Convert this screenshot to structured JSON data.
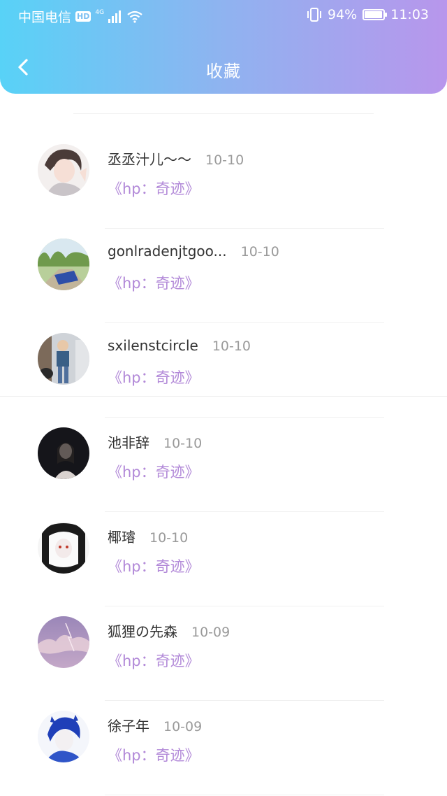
{
  "status_bar": {
    "carrier": "中国电信",
    "hd": "HD",
    "network": "4G",
    "battery": "94%",
    "time": "11:03"
  },
  "nav": {
    "title": "收藏"
  },
  "colors": {
    "accent": "#b289d8",
    "gradient_start": "#58d2f7",
    "gradient_end": "#b896ec"
  },
  "favorites": [
    {
      "name": "丞丞汁儿～～",
      "date": "10-10",
      "book": "《hp：奇迹》"
    },
    {
      "name": "gonlradenjtgoo...",
      "date": "10-10",
      "book": "《hp：奇迹》"
    },
    {
      "name": "sxilenstcircle",
      "date": "10-10",
      "book": "《hp：奇迹》"
    },
    {
      "name": "池非辞",
      "date": "10-10",
      "book": "《hp：奇迹》"
    },
    {
      "name": "椰璿",
      "date": "10-10",
      "book": "《hp：奇迹》"
    },
    {
      "name": "狐狸の先森",
      "date": "10-09",
      "book": "《hp：奇迹》"
    },
    {
      "name": "徐子年",
      "date": "10-09",
      "book": "《hp：奇迹》"
    }
  ]
}
